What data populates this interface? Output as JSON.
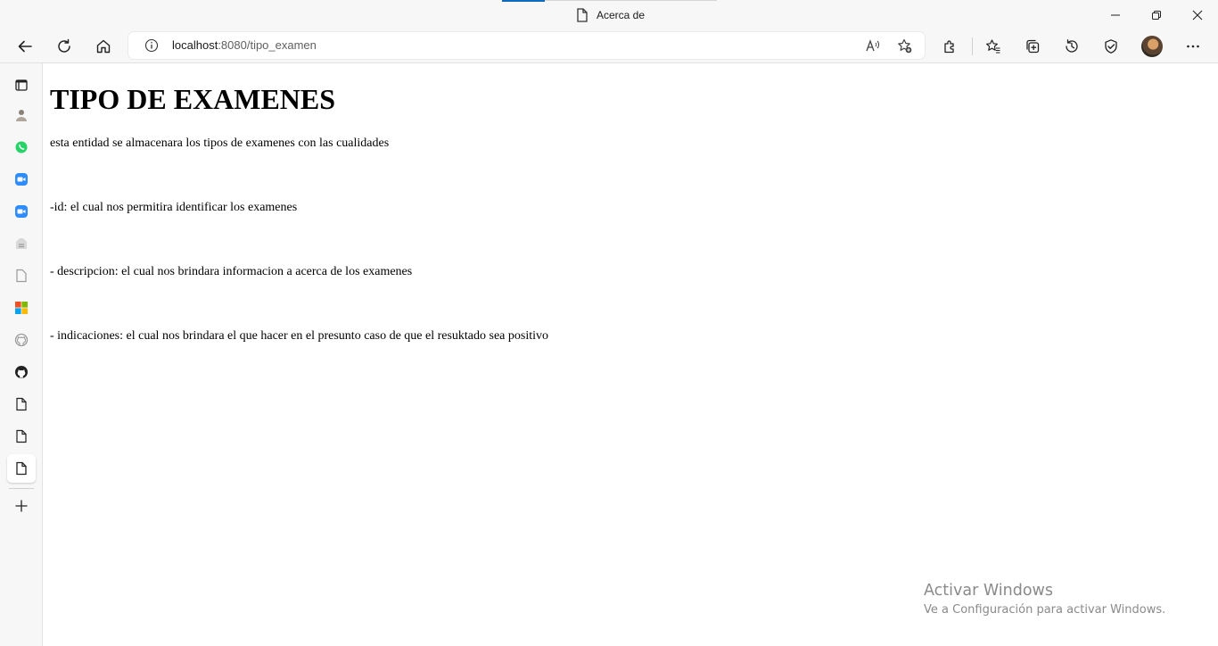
{
  "window": {
    "tab_title": "Acerca de"
  },
  "toolbar": {
    "url_host": "localhost",
    "url_rest": ":8080/tipo_examen"
  },
  "page": {
    "heading": "TIPO DE EXAMENES",
    "paragraphs": [
      "esta entidad se almacenara los tipos de examenes con las cualidades",
      "-id: el cual nos permitira identificar los examenes",
      "- descripcion: el cual nos brindara informacion a acerca de los examenes",
      "- indicaciones: el cual nos brindara el que hacer en el presunto caso de que el resuktado sea positivo"
    ]
  },
  "watermark": {
    "line1": "Activar Windows",
    "line2": "Ve a Configuración para activar Windows."
  },
  "icons": {
    "tab": "page-icon",
    "back": "back-arrow-icon",
    "refresh": "refresh-icon",
    "home": "home-icon",
    "info": "info-icon",
    "read_aloud": "read-aloud-icon",
    "add_favorite": "add-favorite-icon",
    "extensions": "extensions-icon",
    "favorites": "favorites-icon",
    "collections": "collections-icon",
    "history": "history-icon",
    "browser_essentials": "browser-essentials-icon",
    "more": "more-icon"
  },
  "colors": {
    "accent": "#0f6cbd",
    "chrome_bg": "#f7f7f7",
    "page_bg": "#ffffff",
    "watermark": "#8a8a8a"
  }
}
